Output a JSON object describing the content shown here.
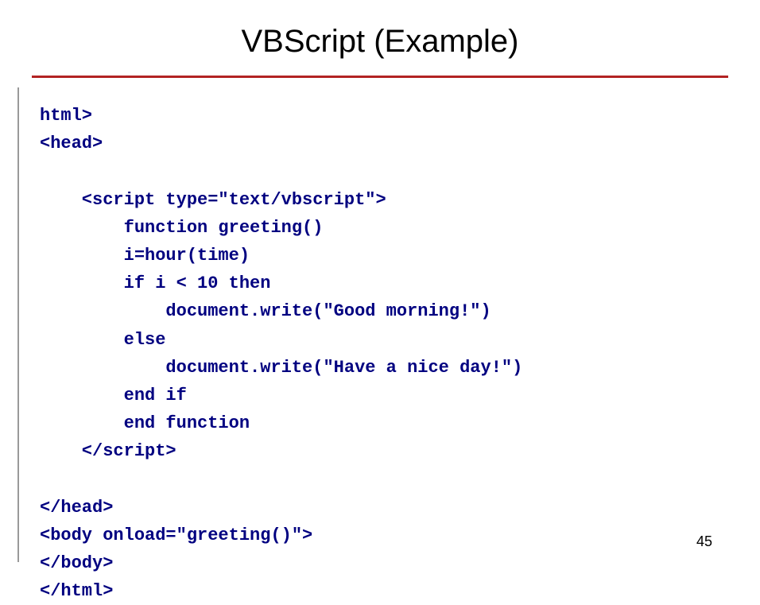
{
  "title": "VBScript (Example)",
  "code_lines": [
    "html>",
    "<head>",
    "",
    "    <script type=\"text/vbscript\">",
    "        function greeting()",
    "        i=hour(time)",
    "        if i < 10 then",
    "            document.write(\"Good morning!\")",
    "        else",
    "            document.write(\"Have a nice day!\")",
    "        end if",
    "        end function",
    "    </script>",
    "",
    "</head>",
    "<body onload=\"greeting()\">",
    "</body>",
    "</html>"
  ],
  "page_number": "45"
}
